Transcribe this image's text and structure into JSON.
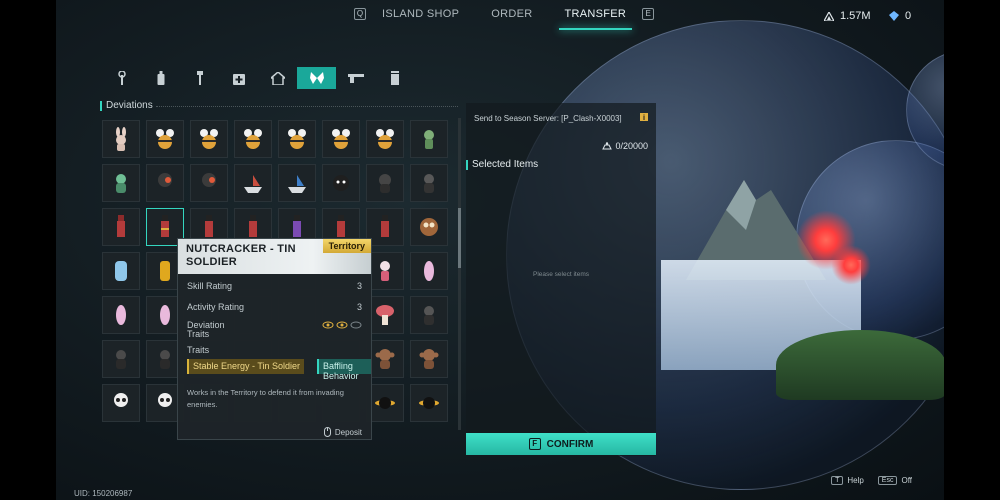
{
  "topnav": {
    "shop_key": "Q",
    "tabs": [
      {
        "label": "ISLAND SHOP",
        "active": false
      },
      {
        "label": "ORDER",
        "active": false
      },
      {
        "label": "TRANSFER",
        "active": true
      }
    ],
    "next_key": "E"
  },
  "currency": {
    "primary_value": "1.57M",
    "secondary_value": "0"
  },
  "category_tabs": [
    {
      "icon": "wrench-icon",
      "active": false
    },
    {
      "icon": "bottle-icon",
      "active": false
    },
    {
      "icon": "tool-icon",
      "active": false
    },
    {
      "icon": "medkit-icon",
      "active": false
    },
    {
      "icon": "house-icon",
      "active": false
    },
    {
      "icon": "butterfly-icon",
      "active": true
    },
    {
      "icon": "gun-icon",
      "active": false
    },
    {
      "icon": "canister-icon",
      "active": false
    }
  ],
  "deviations": {
    "title": "Deviations"
  },
  "tooltip": {
    "name": "NUTCRACKER - TIN SOLDIER",
    "badge": "Territory",
    "skill_rating_label": "Skill Rating",
    "skill_rating_value": "3",
    "activity_rating_label": "Activity Rating",
    "activity_rating_value": "3",
    "deviation_traits_label": "Deviation Traits",
    "traits_label": "Traits",
    "trait_1": "Stable Energy - Tin Soldier",
    "trait_2": "Baffling Behavior",
    "description": "Works in the Territory to defend it from invading enemies.",
    "deposit_label": "Deposit"
  },
  "transfer_panel": {
    "send_to": "Send to Season Server: [P_Clash-X0003]",
    "count": "0/20000",
    "selected_title": "Selected Items",
    "empty_text": "Please select items",
    "confirm_key": "F",
    "confirm_label": "CONFIRM"
  },
  "footer": {
    "uid": "UID: 150206987",
    "help_key": "T",
    "help_label": "Help",
    "off_key": "Esc",
    "off_label": "Off"
  },
  "colors": {
    "accent": "#34d6c0",
    "badge": "#e7c350"
  }
}
